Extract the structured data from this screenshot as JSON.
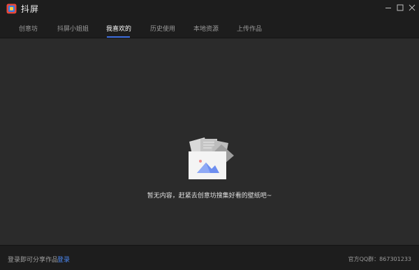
{
  "app": {
    "title": "抖屏"
  },
  "nav": {
    "tabs": [
      {
        "label": "创意坊"
      },
      {
        "label": "抖屏小姐姐"
      },
      {
        "label": "我喜欢的"
      },
      {
        "label": "历史使用"
      },
      {
        "label": "本地资源"
      },
      {
        "label": "上传作品"
      }
    ],
    "active_index": 2
  },
  "main": {
    "empty_message": "暂无内容，赶紧去创意坊搜集好看的壁纸吧~"
  },
  "footer": {
    "hint": "登录即可分享作品",
    "login_link": "登录",
    "qq_group": "官方QQ群：867301233"
  },
  "colors": {
    "accent": "#3f6fe0",
    "link": "#4a86f0",
    "bar_bg": "#1d1d1d",
    "content_bg": "#2b2b2b"
  }
}
